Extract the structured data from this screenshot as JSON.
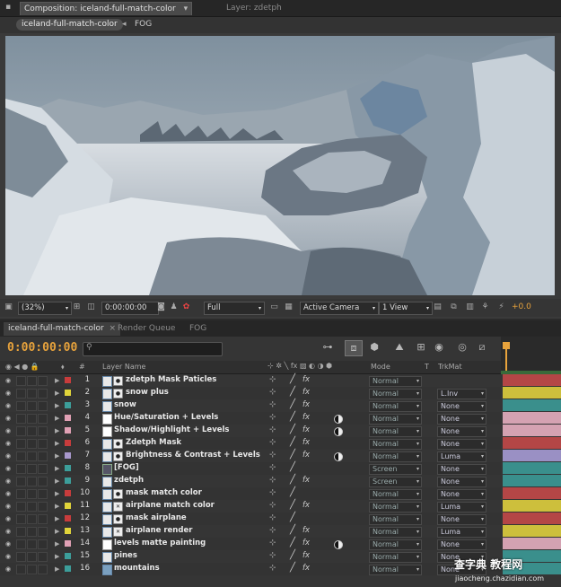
{
  "composition": {
    "tabs": [
      {
        "label": "Composition: iceland-full-match-color",
        "active": true
      },
      {
        "label": "Layer: zdetph",
        "active": false
      }
    ],
    "breadcrumbs": [
      "iceland-full-match-color",
      "FOG"
    ],
    "toolbar": {
      "zoom": "(32%)",
      "timecode": "0:00:00:00",
      "resolution": "Full",
      "camera": "Active Camera",
      "views": "1 View",
      "exposure": "+0.0"
    }
  },
  "timeline": {
    "tabs": [
      {
        "label": "iceland-full-match-color",
        "active": true
      },
      {
        "label": "Render Queue",
        "active": false
      },
      {
        "label": "FOG",
        "active": false
      }
    ],
    "current_time": "0:00:00:00",
    "columns": {
      "number": "#",
      "layer_name": "Layer Name",
      "mode": "Mode",
      "t": "T",
      "trkmat": "TrkMat"
    },
    "layers": [
      {
        "num": "1",
        "name": "zdetph Mask Paticles",
        "label_color": "#c83c3c",
        "type": "precomp-mask",
        "mode": "Normal",
        "trkmat": "",
        "adj": false,
        "pen": true,
        "fx": true,
        "bar": "#b44646"
      },
      {
        "num": "2",
        "name": "snow plus",
        "label_color": "#e0d43a",
        "type": "precomp-mask",
        "mode": "Normal",
        "trkmat": "L.Inv",
        "adj": false,
        "pen": true,
        "fx": true,
        "bar": "#cdbf3c"
      },
      {
        "num": "3",
        "name": "snow",
        "label_color": "#3c9e9a",
        "type": "precomp",
        "mode": "Normal",
        "trkmat": "None",
        "adj": false,
        "pen": true,
        "fx": true,
        "bar": "#3a8f8c"
      },
      {
        "num": "4",
        "name": "Hue/Saturation + Levels",
        "label_color": "#e0a0b4",
        "type": "solid",
        "mode": "Normal",
        "trkmat": "None",
        "adj": true,
        "pen": true,
        "fx": true,
        "bar": "#d4a2b2"
      },
      {
        "num": "5",
        "name": "Shadow/Highlight + Levels",
        "label_color": "#e0a0b4",
        "type": "solid",
        "mode": "Normal",
        "trkmat": "None",
        "adj": true,
        "pen": true,
        "fx": true,
        "bar": "#d4a2b2"
      },
      {
        "num": "6",
        "name": "Zdetph Mask",
        "label_color": "#c83c3c",
        "type": "precomp-mask",
        "mode": "Normal",
        "trkmat": "None",
        "adj": false,
        "pen": true,
        "fx": true,
        "bar": "#b44646"
      },
      {
        "num": "7",
        "name": "Brightness & Contrast + Levels",
        "label_color": "#a898cc",
        "type": "precomp-mask",
        "mode": "Normal",
        "trkmat": "Luma",
        "adj": true,
        "pen": true,
        "fx": true,
        "bar": "#9a90c4"
      },
      {
        "num": "8",
        "name": "[FOG]",
        "label_color": "#3c9e9a",
        "type": "comp",
        "mode": "Screen",
        "trkmat": "None",
        "adj": false,
        "pen": true,
        "fx": false,
        "bar": "#3a8f8c"
      },
      {
        "num": "9",
        "name": "zdetph",
        "label_color": "#3c9e9a",
        "type": "precomp",
        "mode": "Screen",
        "trkmat": "None",
        "adj": false,
        "pen": true,
        "fx": true,
        "bar": "#3a8f8c"
      },
      {
        "num": "10",
        "name": "mask match color",
        "label_color": "#c83c3c",
        "type": "precomp-mask",
        "mode": "Normal",
        "trkmat": "None",
        "adj": false,
        "pen": true,
        "fx": false,
        "bar": "#b44646"
      },
      {
        "num": "11",
        "name": "airplane match color",
        "label_color": "#e0d43a",
        "type": "precomp-x",
        "mode": "Normal",
        "trkmat": "Luma",
        "adj": false,
        "pen": true,
        "fx": true,
        "bar": "#cdbf3c"
      },
      {
        "num": "12",
        "name": "mask airplane",
        "label_color": "#c83c3c",
        "type": "precomp-mask",
        "mode": "Normal",
        "trkmat": "None",
        "adj": false,
        "pen": true,
        "fx": false,
        "bar": "#b44646"
      },
      {
        "num": "13",
        "name": "airplane render",
        "label_color": "#e0d43a",
        "type": "precomp-x",
        "mode": "Normal",
        "trkmat": "Luma",
        "adj": false,
        "pen": true,
        "fx": true,
        "bar": "#cdbf3c"
      },
      {
        "num": "14",
        "name": "levels matte painting",
        "label_color": "#e0a0b4",
        "type": "solid",
        "mode": "Normal",
        "trkmat": "None",
        "adj": true,
        "pen": true,
        "fx": true,
        "bar": "#d4a2b2"
      },
      {
        "num": "15",
        "name": "pines",
        "label_color": "#3c9e9a",
        "type": "precomp",
        "mode": "Normal",
        "trkmat": "None",
        "adj": false,
        "pen": true,
        "fx": true,
        "bar": "#3a8f8c"
      },
      {
        "num": "16",
        "name": "mountains",
        "label_color": "#3c9e9a",
        "type": "image",
        "mode": "Normal",
        "trkmat": "None",
        "adj": false,
        "pen": true,
        "fx": true,
        "bar": "#3a8f8c"
      }
    ]
  },
  "watermark": {
    "main": "查字典 教程网",
    "url": "jiaocheng.chazidian.com"
  }
}
